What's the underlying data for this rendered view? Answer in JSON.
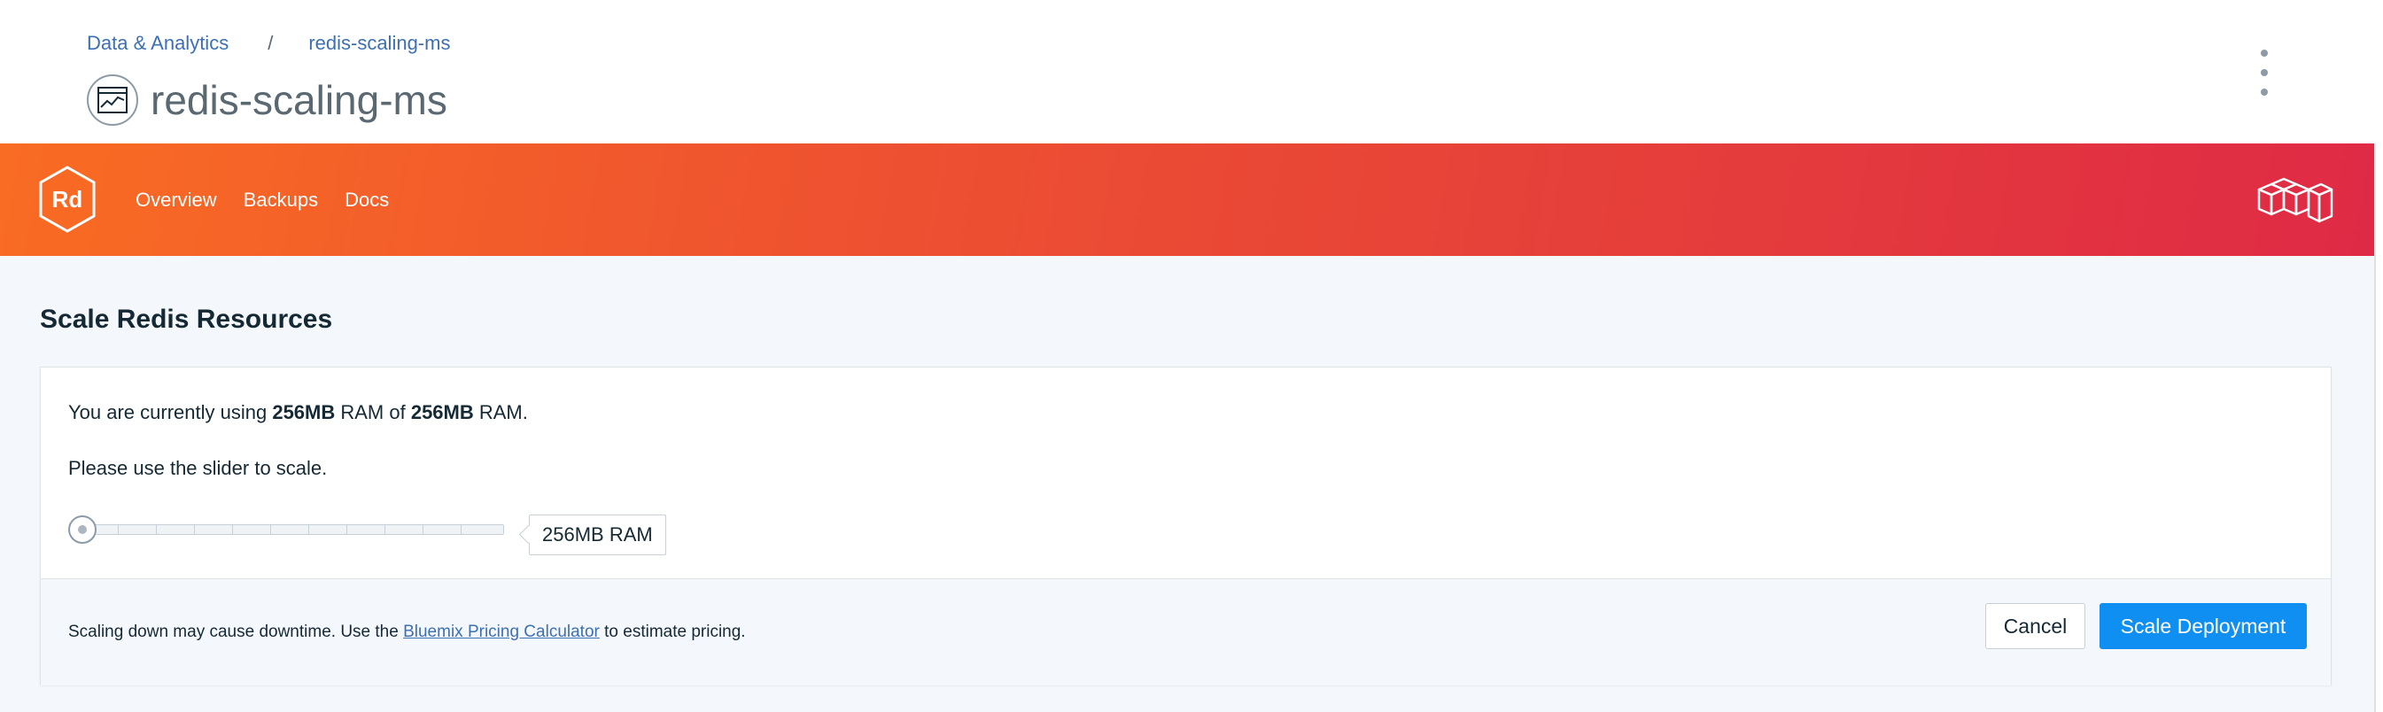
{
  "breadcrumb": {
    "parent": "Data & Analytics",
    "separator": "/",
    "current": "redis-scaling-ms"
  },
  "page": {
    "title": "redis-scaling-ms",
    "icon": "chart-window-icon",
    "menu_icon": "overflow-menu-vertical-icon"
  },
  "banner": {
    "logo_text": "Rd",
    "nav": [
      "Overview",
      "Backups",
      "Docs"
    ],
    "right_logo": "cubes-icon",
    "gradient": [
      "#f96c23",
      "#df2a45"
    ]
  },
  "scale": {
    "section_title": "Scale Redis Resources",
    "usage_prefix": "You are currently using ",
    "usage_current": "256MB",
    "usage_mid": " RAM of ",
    "usage_total": "256MB",
    "usage_suffix": " RAM.",
    "instructions": "Please use the slider to scale.",
    "slider_value_label": "256MB RAM",
    "slider_level": 0,
    "footer_prefix": "Scaling down may cause downtime. Use the ",
    "footer_link": "Bluemix Pricing Calculator",
    "footer_suffix": " to estimate pricing.",
    "cancel_label": "Cancel",
    "submit_label": "Scale Deployment"
  },
  "colors": {
    "primary_button": "#0f8ff2",
    "link": "#3d70b2"
  }
}
